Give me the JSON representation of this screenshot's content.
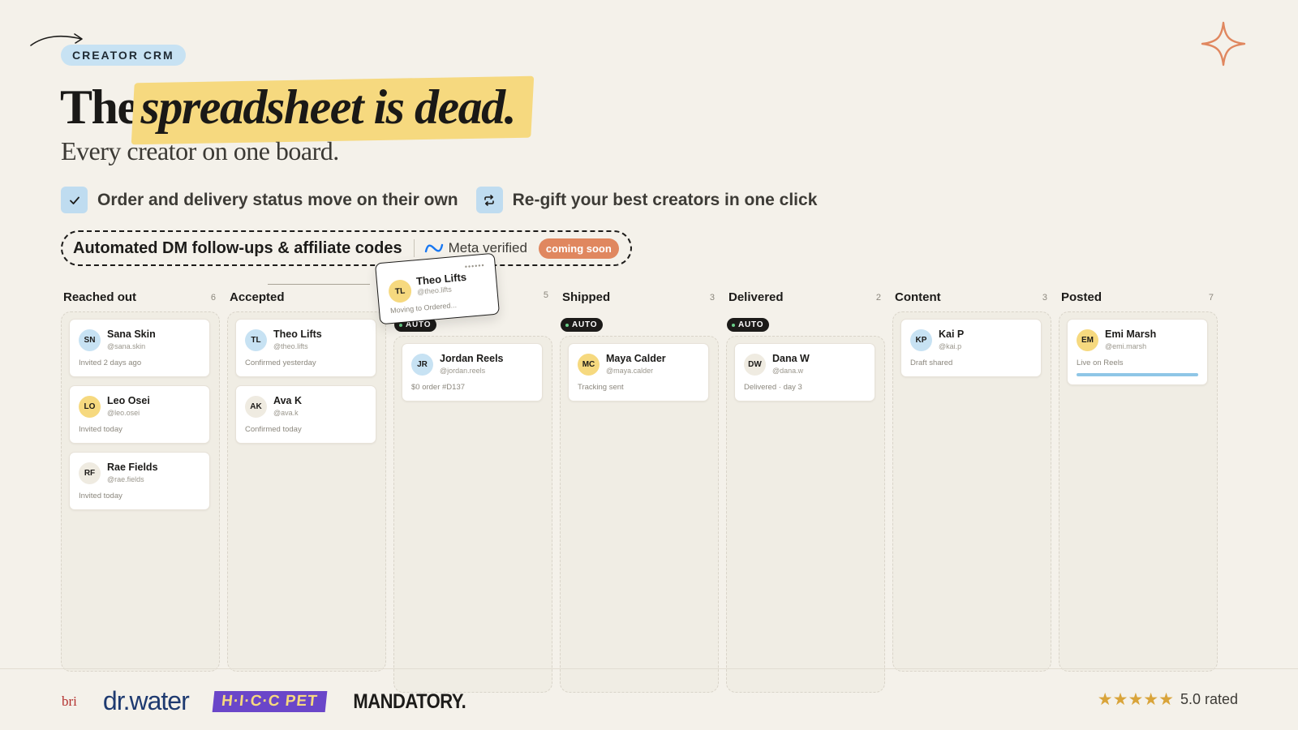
{
  "eyebrow": "CREATOR CRM",
  "headline": {
    "prefix": "The",
    "highlight": "spreadsheet is dead."
  },
  "subhead": "Every creator on one board.",
  "features": [
    {
      "icon": "checkmark-icon",
      "label": "Order and delivery status move on their own"
    },
    {
      "icon": "repeat-icon",
      "label": "Re-gift your best creators in one click"
    }
  ],
  "banner": {
    "title": "Automated DM follow-ups & affiliate codes",
    "meta_label": "Meta verified",
    "badge": "coming soon"
  },
  "auto_label": "AUTO",
  "columns": [
    {
      "title": "Reached out",
      "count": "6",
      "auto": false,
      "cards": [
        {
          "initials": "SN",
          "name": "Sana Skin",
          "handle": "@sana.skin",
          "status": "Invited 2 days ago",
          "avatar": "blue"
        },
        {
          "initials": "LO",
          "name": "Leo Osei",
          "handle": "@leo.osei",
          "status": "Invited today",
          "avatar": "yellow"
        },
        {
          "initials": "RF",
          "name": "Rae Fields",
          "handle": "@rae.fields",
          "status": "Invited today",
          "avatar": "cream"
        }
      ]
    },
    {
      "title": "Accepted",
      "count": "",
      "auto": false,
      "cards": [
        {
          "initials": "TL",
          "name": "Theo Lifts",
          "handle": "@theo.lifts",
          "status": "Confirmed yesterday",
          "avatar": "blue"
        },
        {
          "initials": "AK",
          "name": "Ava K",
          "handle": "@ava.k",
          "status": "Confirmed today",
          "avatar": "cream"
        }
      ]
    },
    {
      "title": "",
      "count": "5",
      "auto": true,
      "cards": [
        {
          "initials": "JR",
          "name": "Jordan Reels",
          "handle": "@jordan.reels",
          "status": "$0 order #D137",
          "avatar": "blue"
        }
      ]
    },
    {
      "title": "Shipped",
      "count": "3",
      "auto": true,
      "cards": [
        {
          "initials": "MC",
          "name": "Maya Calder",
          "handle": "@maya.calder",
          "status": "Tracking sent",
          "avatar": "yellow"
        }
      ]
    },
    {
      "title": "Delivered",
      "count": "2",
      "auto": true,
      "cards": [
        {
          "initials": "DW",
          "name": "Dana W",
          "handle": "@dana.w",
          "status": "Delivered · day 3",
          "avatar": "cream"
        }
      ]
    },
    {
      "title": "Content",
      "count": "3",
      "auto": false,
      "cards": [
        {
          "initials": "KP",
          "name": "Kai P",
          "handle": "@kai.p",
          "status": "Draft shared",
          "avatar": "blue"
        }
      ]
    },
    {
      "title": "Posted",
      "count": "7",
      "auto": false,
      "cards": [
        {
          "initials": "EM",
          "name": "Emi Marsh",
          "handle": "@emi.marsh",
          "status": "Live on Reels",
          "avatar": "yellow",
          "progress": 1.0
        }
      ]
    }
  ],
  "drag_card": {
    "initials": "TL",
    "name": "Theo Lifts",
    "handle": "@theo.lifts",
    "status": "Moving to Ordered..."
  },
  "logos": {
    "bri": "bri",
    "drwater": "dr.water",
    "hicc": "H·I·C·C PET",
    "mandatory": "MANDATORY."
  },
  "rating": {
    "stars": "★★★★★",
    "label": "5.0 rated",
    "value": 5.0
  },
  "colors": {
    "background": "#f4f1ea",
    "highlight": "#f6d97f",
    "accent_blue": "#c7e2f3",
    "badge_orange": "#e0875f",
    "star": "#d9a43a"
  }
}
